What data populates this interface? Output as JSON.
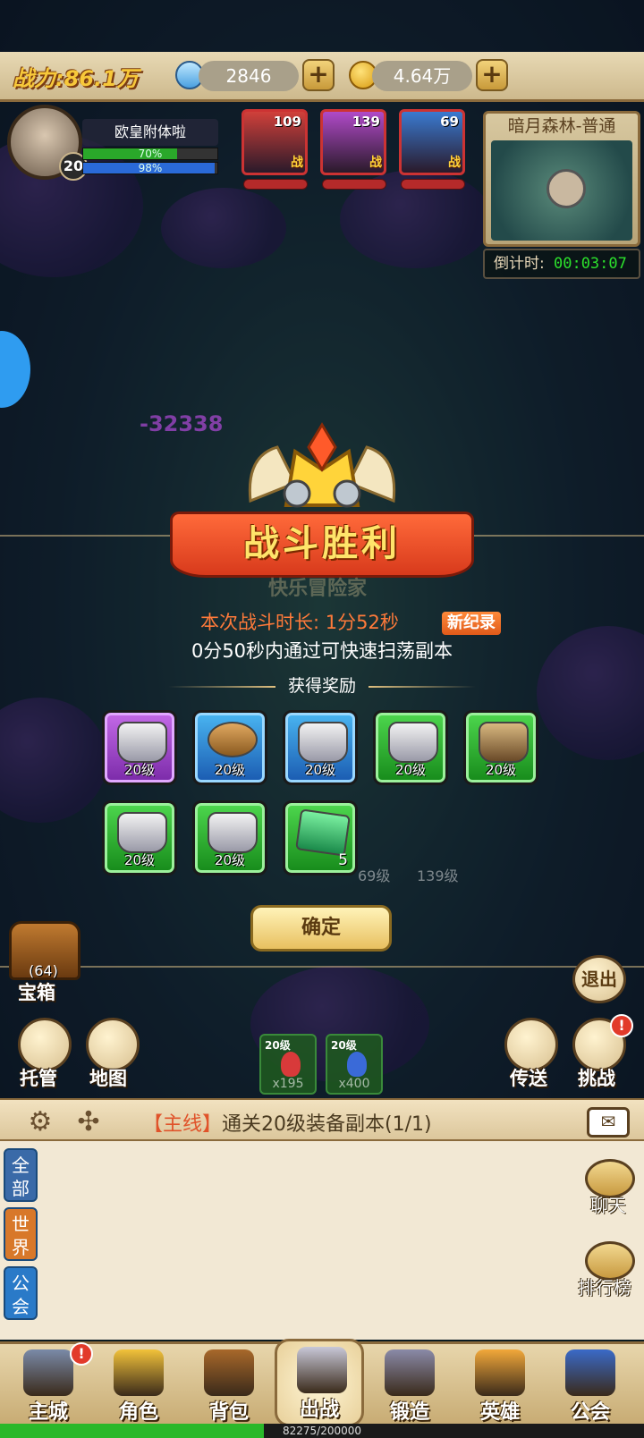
{
  "top": {
    "power": "战力:86.1万",
    "gems": "2846",
    "gold": "4.64万",
    "plus": "+"
  },
  "player": {
    "name": "欧皇附体啦",
    "level": "20",
    "hp_text": "70%",
    "hp_fraction": 0.7,
    "mp_text": "98%",
    "mp_fraction": 0.98
  },
  "heroes": [
    {
      "level": "109",
      "tag": "战",
      "color": "#d0403a"
    },
    {
      "level": "139",
      "tag": "战",
      "color": "#b04ac8"
    },
    {
      "level": "69",
      "tag": "战",
      "color": "#3a7ad0"
    }
  ],
  "map": {
    "title": "暗月森林-普通",
    "timer_label": "倒计时:",
    "timer_value": "00:03:07"
  },
  "battle": {
    "damage": "-32338",
    "title": "战斗胜利",
    "ghost_name": "快乐冒险家",
    "duration": "本次战斗时长: 1分52秒",
    "record": "新纪录",
    "sweep_hint": "0分50秒内通过可快速扫荡副本",
    "rewards_title": "获得奖励",
    "confirm": "确定",
    "rewards": [
      {
        "label": "20级",
        "rarity": "purple",
        "icon": "armor-icon"
      },
      {
        "label": "20级",
        "rarity": "blue",
        "icon": "belt-icon"
      },
      {
        "label": "20级",
        "rarity": "blue",
        "icon": "armor-icon"
      },
      {
        "label": "20级",
        "rarity": "green",
        "icon": "armor-icon"
      },
      {
        "label": "20级",
        "rarity": "green",
        "icon": "boots-icon"
      },
      {
        "label": "20级",
        "rarity": "green",
        "icon": "gauntlet-icon"
      },
      {
        "label": "20级",
        "rarity": "green",
        "icon": "helmet-icon"
      },
      {
        "label": "",
        "count": "5",
        "rarity": "green",
        "icon": "gem-icon"
      }
    ],
    "ghost_levels": [
      "69级",
      "139级"
    ]
  },
  "side": {
    "chest_count": "(64)",
    "chest_label": "宝箱",
    "auto_label": "托管",
    "map_label": "地图",
    "exit_label": "退出",
    "teleport_label": "传送",
    "challenge_label": "挑战",
    "challenge_badge": "!"
  },
  "potions": [
    {
      "level": "20级",
      "count": "x195",
      "color": "#d83a3a"
    },
    {
      "level": "20级",
      "count": "x400",
      "color": "#3a6ad8"
    }
  ],
  "quest": {
    "tag": "【主线】",
    "text": "通关20级装备副本(1/1)"
  },
  "chat": {
    "tabs": [
      "全部",
      "世界",
      "公会"
    ],
    "chat_label": "聊天",
    "rank_label": "排行榜"
  },
  "nav": [
    {
      "label": "主城",
      "badge": "!"
    },
    {
      "label": "角色"
    },
    {
      "label": "背包"
    },
    {
      "label": "出战",
      "active": true
    },
    {
      "label": "锻造"
    },
    {
      "label": "英雄"
    },
    {
      "label": "公会"
    }
  ],
  "xp": {
    "text": "82275/200000",
    "fraction": 0.41
  }
}
